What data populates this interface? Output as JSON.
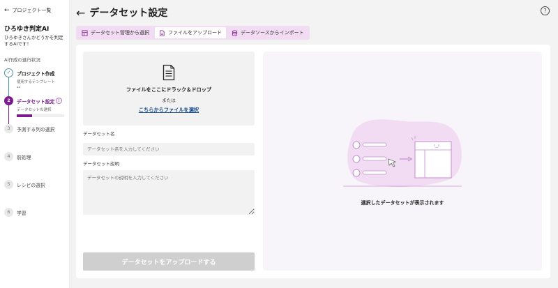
{
  "sidebar": {
    "back_label": "プロジェクト一覧",
    "project_title": "ひろゆき判定AI",
    "project_desc": "ひろゆきさんかどうかを判定するAIです！",
    "progress_label": "AI作成の進行状況",
    "steps": [
      {
        "num": "✓",
        "title": "プロジェクト作成",
        "sub": "使用するテンプレート",
        "value": "--"
      },
      {
        "num": "2",
        "title": "データセット設定",
        "sub": "データセットの選択"
      },
      {
        "num": "3",
        "title": "予測する列の選択"
      },
      {
        "num": "4",
        "title": "前処理"
      },
      {
        "num": "5",
        "title": "レシピの選択"
      },
      {
        "num": "6",
        "title": "学習"
      }
    ],
    "step2_progress": 0.33,
    "info_glyph": "!"
  },
  "header": {
    "title": "データセット設定",
    "help_glyph": "?"
  },
  "tabs": [
    {
      "label": "データセット管理から選択",
      "icon": "dataset-icon"
    },
    {
      "label": "ファイルをアップロード",
      "icon": "file-icon"
    },
    {
      "label": "データソースからインポート",
      "icon": "database-icon"
    }
  ],
  "upload": {
    "drop_text": "ファイルをここにドラック＆ドロップ",
    "or_text": "または",
    "select_link": "こちらからファイルを選択",
    "name_label": "データセット名",
    "name_placeholder": "データセット名を入力してください",
    "desc_label": "データセット説明",
    "desc_placeholder": "データセットの説明を入力してください",
    "button_label": "データセットをアップロードする"
  },
  "preview": {
    "text": "選択したデータセットが表示されます"
  },
  "colors": {
    "accent": "#7a1a8c",
    "done": "#4a90a4",
    "tab_bg": "#f1dcf3"
  }
}
